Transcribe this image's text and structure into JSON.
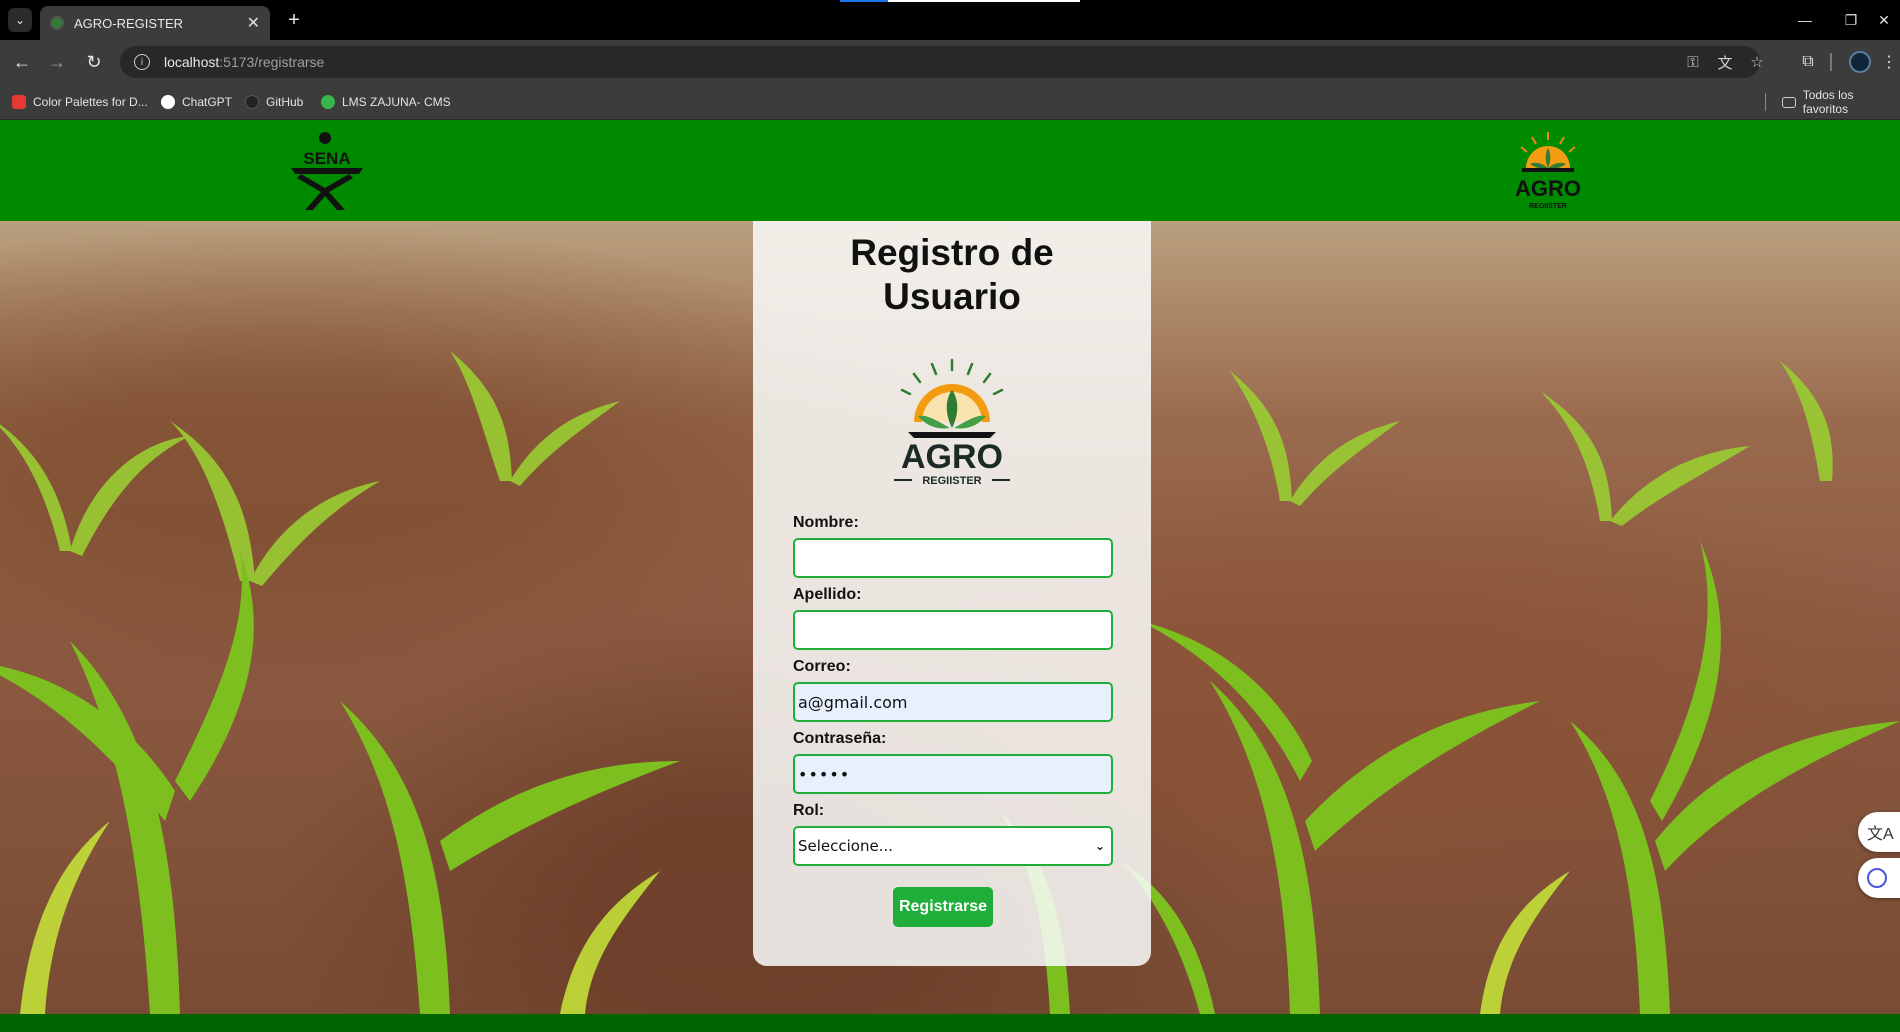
{
  "browser": {
    "tab_title": "AGRO-REGISTER",
    "url_host": "localhost",
    "url_path": ":5173/registrarse",
    "bookmarks": [
      {
        "label": "Color Palettes for D...",
        "color": "#e53935"
      },
      {
        "label": "ChatGPT",
        "color": "#ffffff"
      },
      {
        "label": "GitHub",
        "color": "#222222"
      },
      {
        "label": "LMS ZAJUNA- CMS",
        "color": "#39b54a"
      }
    ],
    "all_bookmarks_label": "Todos los favoritos"
  },
  "header": {
    "sena_logo_text": "SENA",
    "agro_logo_text": "AGRO",
    "agro_logo_sub": "REGIISTER",
    "bg_color": "#008a00"
  },
  "form": {
    "title_line1": "Registro de",
    "title_line2": "Usuario",
    "logo_text": "AGRO",
    "logo_sub": "REGIISTER",
    "nombre_label": "Nombre:",
    "nombre_value": "",
    "apellido_label": "Apellido:",
    "apellido_value": "",
    "correo_label": "Correo:",
    "correo_value": "a@gmail.com",
    "password_label": "Contraseña:",
    "password_value": "•••••",
    "rol_label": "Rol:",
    "rol_selected": "Seleccione...",
    "submit_label": "Registrarse",
    "accent_color": "#1fae3a"
  }
}
